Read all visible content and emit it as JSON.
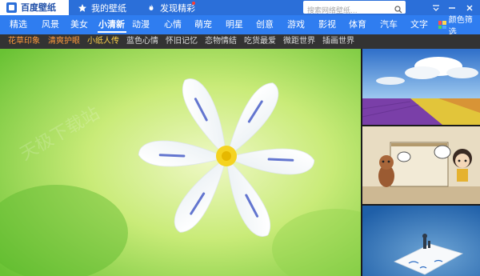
{
  "app": {
    "title": "百度壁纸"
  },
  "titlebar": {
    "nav": [
      {
        "label": "我的壁纸",
        "icon": "star-icon"
      },
      {
        "label": "发现精彩",
        "icon": "flame-icon"
      }
    ],
    "search_placeholder": "搜索网络壁纸...",
    "controls": [
      "menu-icon",
      "minimize-icon",
      "close-icon"
    ]
  },
  "categories": {
    "items": [
      "精选",
      "风景",
      "美女",
      "小清新",
      "动漫",
      "心情",
      "萌宠",
      "明星",
      "创意",
      "游戏",
      "影视",
      "体育",
      "汽车",
      "文字"
    ],
    "active": "小清新",
    "color_filter_label": "颜色筛选"
  },
  "subcategories": {
    "items": [
      {
        "label": "花草印象",
        "color": "#ff9a3c"
      },
      {
        "label": "清爽护眼",
        "color": "#ff9a3c"
      },
      {
        "label": "小纸人传",
        "color": "#ffd24a"
      },
      {
        "label": "蓝色心情",
        "color": "#e6e6e6"
      },
      {
        "label": "怀旧记忆",
        "color": "#e6e6e6"
      },
      {
        "label": "恋物情结",
        "color": "#e6e6e6"
      },
      {
        "label": "吃货最爱",
        "color": "#e6e6e6"
      },
      {
        "label": "微距世界",
        "color": "#e6e6e6"
      },
      {
        "label": "插画世界",
        "color": "#e6e6e6"
      }
    ]
  },
  "content": {
    "watermark": "天极下载站",
    "thumbnails": [
      "tulip-field-thumbnail",
      "cartoon-dog-girl-thumbnail",
      "paper-figure-thumbnail"
    ]
  },
  "colors": {
    "titlebar": "#2b6fd9",
    "category_bar": "#2f7df0",
    "sub_bar": "#333333"
  }
}
